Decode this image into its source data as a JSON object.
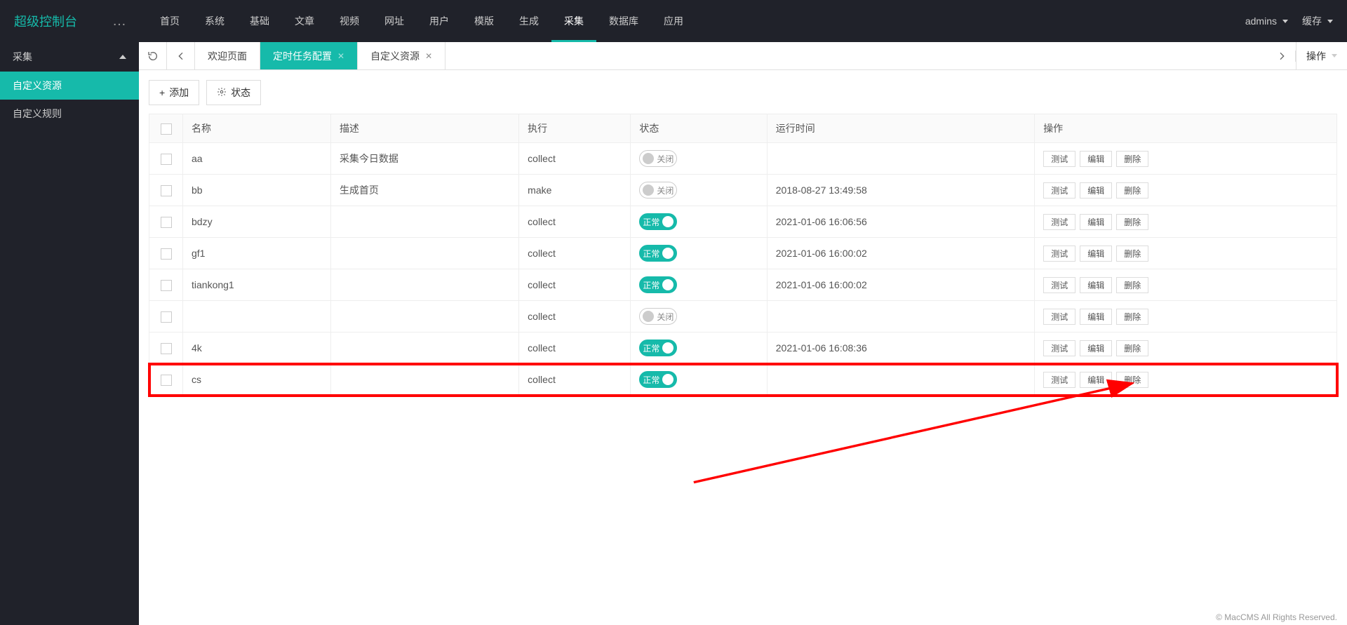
{
  "logo": "超级控制台",
  "topnav": [
    "首页",
    "系统",
    "基础",
    "文章",
    "视频",
    "网址",
    "用户",
    "模版",
    "生成",
    "采集",
    "数据库",
    "应用"
  ],
  "topnav_active": 9,
  "user": "admins",
  "cache": "缓存",
  "sidebar": {
    "title": "采集",
    "items": [
      "自定义资源",
      "自定义规则"
    ],
    "active": 0
  },
  "tabs": {
    "items": [
      {
        "label": "欢迎页面",
        "closable": false
      },
      {
        "label": "定时任务配置",
        "closable": true,
        "active": true
      },
      {
        "label": "自定义资源",
        "closable": true
      }
    ],
    "ops_label": "操作"
  },
  "toolbar": {
    "add": "添加",
    "status": "状态"
  },
  "table": {
    "headers": [
      "名称",
      "描述",
      "执行",
      "状态",
      "运行时间",
      "操作"
    ],
    "actions": {
      "test": "测试",
      "edit": "编辑",
      "delete": "删除"
    },
    "status_on": "正常",
    "status_off": "关闭",
    "rows": [
      {
        "name": "aa",
        "desc": "采集今日数据",
        "exec": "collect",
        "on": false,
        "runtime": ""
      },
      {
        "name": "bb",
        "desc": "生成首页",
        "exec": "make",
        "on": false,
        "runtime": "2018-08-27 13:49:58"
      },
      {
        "name": "bdzy",
        "desc": "",
        "exec": "collect",
        "on": true,
        "runtime": "2021-01-06 16:06:56"
      },
      {
        "name": "gf1",
        "desc": "",
        "exec": "collect",
        "on": true,
        "runtime": "2021-01-06 16:00:02"
      },
      {
        "name": "tiankong1",
        "desc": "",
        "exec": "collect",
        "on": true,
        "runtime": "2021-01-06 16:00:02"
      },
      {
        "name": "",
        "desc": "",
        "exec": "collect",
        "on": false,
        "runtime": ""
      },
      {
        "name": "4k",
        "desc": "",
        "exec": "collect",
        "on": true,
        "runtime": "2021-01-06 16:08:36"
      },
      {
        "name": "cs",
        "desc": "",
        "exec": "collect",
        "on": true,
        "runtime": "",
        "highlight": true
      }
    ]
  },
  "footer": "© MacCMS All Rights Reserved."
}
